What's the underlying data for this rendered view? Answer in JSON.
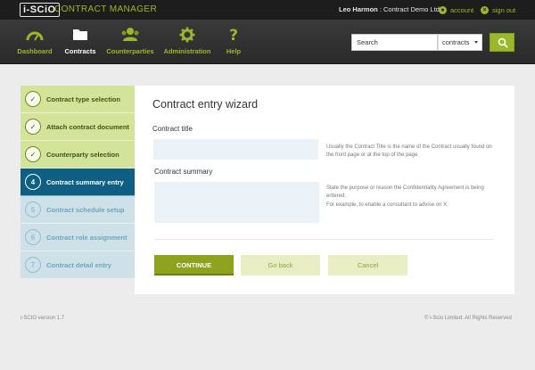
{
  "header": {
    "logo_text": "i-SCiO",
    "app_name": "CONTRACT MANAGER",
    "user_name": "Leo Harmon",
    "user_org": " : Contract Demo Ltd",
    "account_label": "account",
    "signout_label": "sign out",
    "accent_color": "#9bb82a"
  },
  "nav": {
    "items": [
      {
        "label": "Dashboard",
        "icon": "gauge-icon"
      },
      {
        "label": "Contracts",
        "icon": "folder-icon",
        "active": true
      },
      {
        "label": "Counterparties",
        "icon": "people-icon"
      },
      {
        "label": "Administration",
        "icon": "gear-icon"
      },
      {
        "label": "Help",
        "icon": "question-icon"
      }
    ]
  },
  "search": {
    "placeholder": "Search",
    "scope_selected": "contracts"
  },
  "steps": [
    {
      "number": "✓",
      "label": "Contract type selection",
      "state": "done"
    },
    {
      "number": "✓",
      "label": "Attach contract document",
      "state": "done"
    },
    {
      "number": "✓",
      "label": "Counterparty selection",
      "state": "done"
    },
    {
      "number": "4",
      "label": "Contract summary entry",
      "state": "current"
    },
    {
      "number": "5",
      "label": "Contract schedule setup",
      "state": "todo"
    },
    {
      "number": "6",
      "label": "Contract role assignment",
      "state": "todo"
    },
    {
      "number": "7",
      "label": "Contract detail entry",
      "state": "todo"
    }
  ],
  "form": {
    "title": "Contract entry wizard",
    "contract_title_label": "Contract title",
    "contract_title_help": "Usually the Contract Title is the name of the Contract usually found on the front page or at the top of the page",
    "contract_summary_label": "Contract summary",
    "contract_summary_help_1": "State the purpose or reason the Confidentiality Agreement is being entered.",
    "contract_summary_help_2": "For example, to enable a consultant to advise on X.",
    "continue_label": "CONTINUE",
    "back_label": "Go back",
    "cancel_label": "Cancel"
  },
  "footer": {
    "version": "i-SCIO version 1.7",
    "copyright": "© i-Scio Limited. All Rights Reserved"
  }
}
